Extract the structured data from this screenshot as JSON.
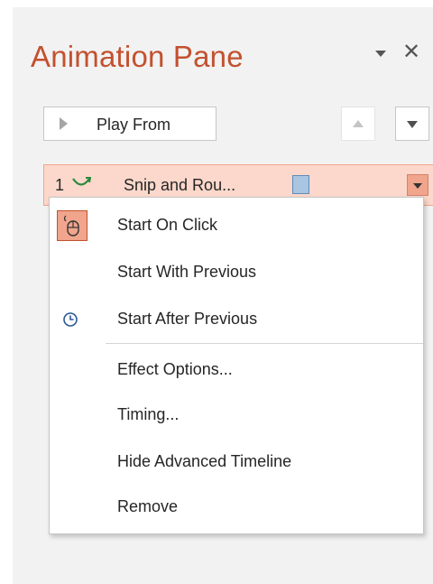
{
  "pane": {
    "title": "Animation Pane",
    "close_glyph": "✕",
    "options_icon": "triangle-down-icon"
  },
  "toolbar": {
    "play_from_label": "Play From",
    "play_icon": "play-triangle-icon",
    "move_up_icon": "arrow-up-icon",
    "move_down_icon": "arrow-down-icon"
  },
  "animation_item": {
    "number": "1",
    "effect_icon": "motion-path-icon",
    "name": "Snip and Rou...",
    "selected": true
  },
  "context_menu": {
    "items": [
      {
        "label": "Start On Click",
        "icon": "mouse-icon",
        "checked": true
      },
      {
        "label": "Start With Previous",
        "icon": ""
      },
      {
        "label": "Start After Previous",
        "icon": "clock-icon"
      },
      {
        "label": "Effect Options..."
      },
      {
        "label": "Timing..."
      },
      {
        "label": "Hide Advanced Timeline"
      },
      {
        "label": "Remove"
      }
    ]
  },
  "colors": {
    "accent": "#c3512f",
    "selection_bg": "#fbd8cb",
    "selection_border": "#f0a58c",
    "pane_bg": "#f2f2f2",
    "timeline_bar": "#a8c5e2"
  }
}
